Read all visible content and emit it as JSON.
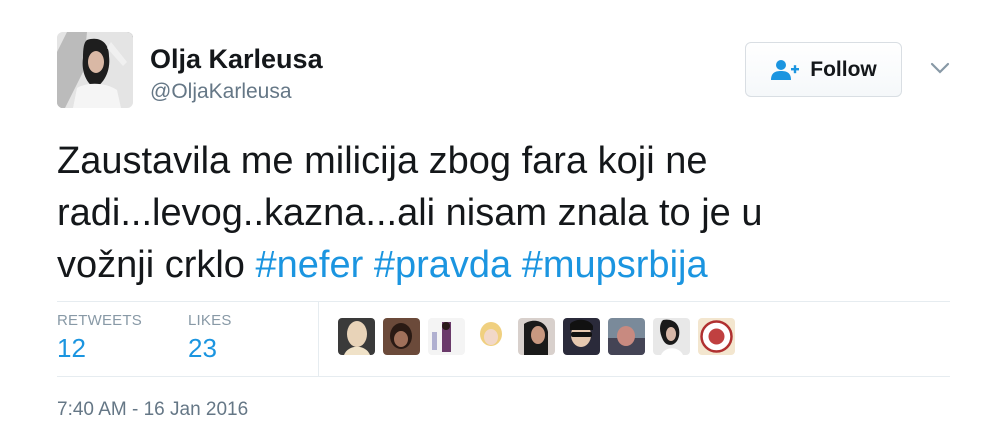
{
  "user": {
    "name": "Olja Karleusa",
    "handle": "@OljaKarleusa"
  },
  "follow_button": {
    "label": "Follow",
    "icon": "follow-user-icon"
  },
  "more_menu": {
    "icon": "chevron-down-icon"
  },
  "tweet": {
    "text_line1": "Zaustavila me milicija zbog fara koji ne",
    "text_line2": "radi...levog..kazna...ali nisam znala to je u",
    "text_line3_plain": "vožnji crklo",
    "hashtags": [
      "#nefer",
      "#pravda",
      "#mupsrbija"
    ]
  },
  "stats": {
    "retweets": {
      "label": "RETWEETS",
      "value": "12"
    },
    "likes": {
      "label": "LIKES",
      "value": "23"
    }
  },
  "likers_count": 9,
  "timestamp": "7:40 AM - 16 Jan 2016",
  "colors": {
    "link": "#1b95e0",
    "muted": "#657786",
    "text": "#14171a"
  }
}
